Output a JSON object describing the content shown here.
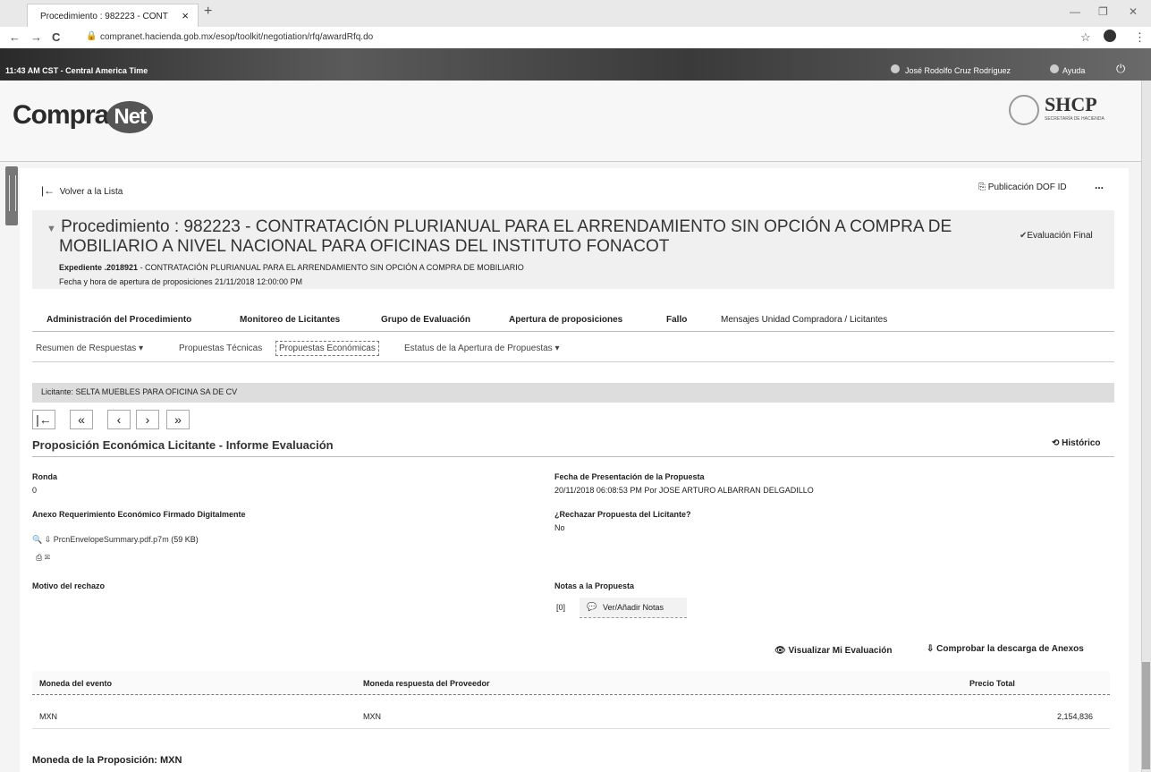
{
  "browser": {
    "tab_title": "Procedimiento : 982223 - CONT",
    "tab_close": "×",
    "new_tab": "+",
    "url": "compranet.hacienda.gob.mx/esop/toolkit/negotiation/rfq/awardRfq.do",
    "back": "←",
    "forward": "→",
    "reload": "C",
    "star": "☆",
    "menu": "⋮"
  },
  "topbar": {
    "time": "11:43 AM CST - Central America Time",
    "user": "José Rodolfo Cruz Rodríguez",
    "help": "Ayuda"
  },
  "header": {
    "logo_left": "Compra",
    "logo_net": "Net",
    "agency": "SHCP",
    "agency_sub": "SECRETARÍA DE HACIENDA"
  },
  "page": {
    "back_link": "Volver a la Lista",
    "publicacion": "Publicación DOF ID",
    "more": "...",
    "proc_line1": "Procedimiento : 982223 - CONTRATACIÓN PLURIANUAL PARA EL ARRENDAMIENTO SIN OPCIÓN A COMPRA DE",
    "proc_line2": "MOBILIARIO A NIVEL NACIONAL PARA OFICINAS DEL INSTITUTO FONACOT",
    "status": "Evaluación Final",
    "expediente_label": "Expediente .2018921",
    "expediente_text": " - CONTRATACIÓN PLURIANUAL PARA EL ARRENDAMIENTO SIN OPCIÓN A COMPRA DE MOBILIARIO",
    "fecha_apertura": "Fecha y hora de apertura de proposiciones 21/11/2018 12:00:00 PM"
  },
  "tabs": [
    "Administración del Procedimiento",
    "Monitoreo de Licitantes",
    "Grupo de Evaluación",
    "Apertura de proposiciones",
    "Fallo",
    "Mensajes Unidad Compradora / Licitantes"
  ],
  "subtabs": [
    "Resumen de Respuestas",
    "Propuestas Técnicas",
    "Propuestas Económicas",
    "Estatus de la Apertura de Propuestas"
  ],
  "licitante": "Licitante: SELTA MUEBLES PARA OFICINA SA DE CV",
  "pager": [
    "|←",
    "«",
    "‹",
    "›",
    "»"
  ],
  "section_title": "Proposición Económica Licitante - Informe Evaluación",
  "historico": "Histórico",
  "fields": {
    "ronda_label": "Ronda",
    "ronda_value": "0",
    "fecha_pres_label": "Fecha de Presentación de la Propuesta",
    "fecha_pres_value": "20/11/2018 06:08:53 PM Por JOSE ARTURO ALBARRAN DELGADILLO",
    "anexo_label": "Anexo Requerimiento Económico Firmado Digitalmente",
    "anexo_file": "PrcnEnvelopeSummary.pdf.p7m",
    "anexo_size": "(59 KB)",
    "rechazar_label": "¿Rechazar Propuesta del Licitante?",
    "rechazar_value": "No",
    "motivo_label": "Motivo del rechazo",
    "notas_label": "Notas a la Propuesta",
    "notas_count": "[0]",
    "notas_button": "Ver/Añadir Notas"
  },
  "actions": {
    "visualizar": "Visualizar Mi Evaluación",
    "comprobar": "Comprobar la descarga de Anexos"
  },
  "table": {
    "headers": [
      "Moneda del evento",
      "Moneda respuesta del Proveedor",
      "Precio Total"
    ],
    "row": [
      "MXN",
      "MXN",
      "2,154,836"
    ]
  },
  "footer_text": "Moneda de la Proposición: MXN"
}
